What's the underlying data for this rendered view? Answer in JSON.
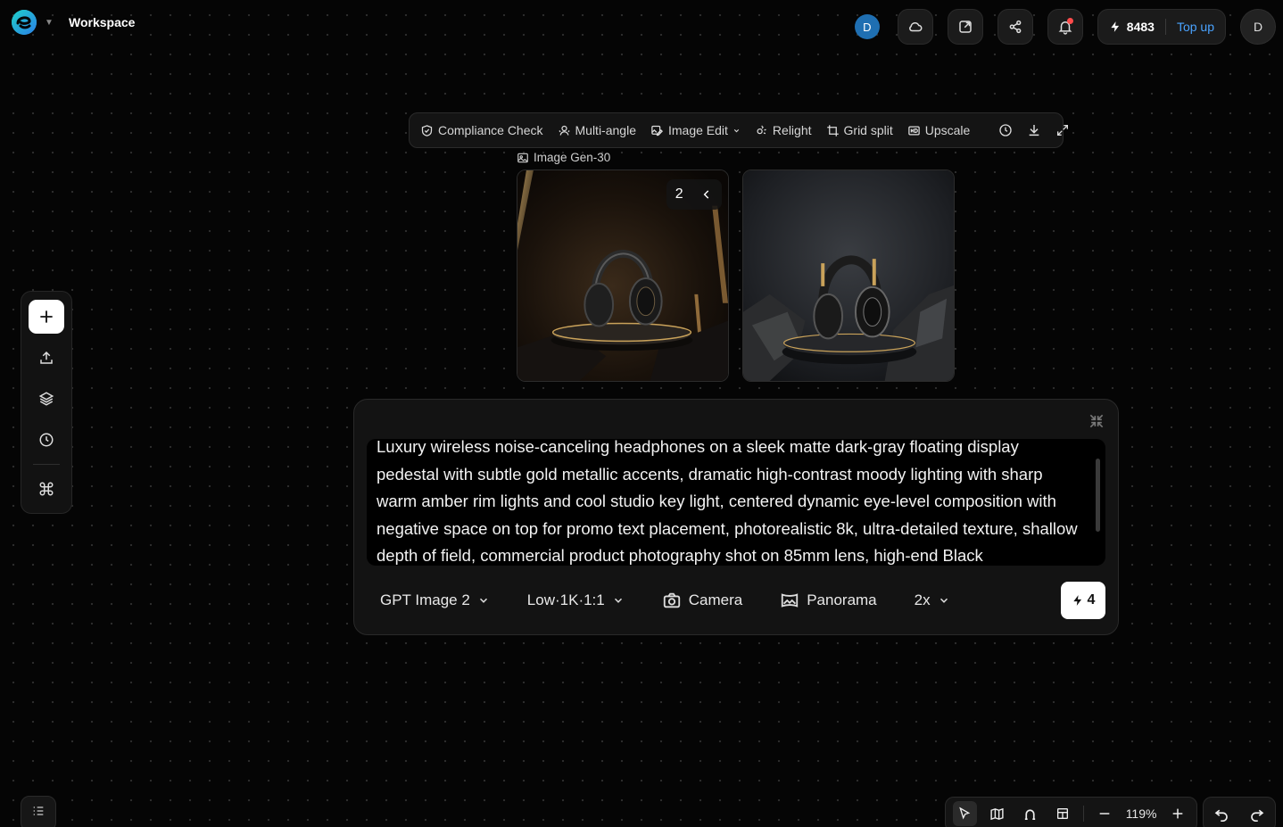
{
  "header": {
    "workspace_title": "Workspace",
    "user_initial": "D",
    "credits": "8483",
    "topup_label": "Top up",
    "avatar_initial": "D"
  },
  "image_toolbar": {
    "items": [
      {
        "label": "Compliance Check",
        "icon": "shield-check-icon"
      },
      {
        "label": "Multi-angle",
        "icon": "multi-angle-icon"
      },
      {
        "label": "Image Edit",
        "icon": "image-edit-icon"
      },
      {
        "label": "Relight",
        "icon": "relight-icon"
      },
      {
        "label": "Grid split",
        "icon": "crop-icon"
      },
      {
        "label": "Upscale",
        "icon": "hd-icon"
      }
    ]
  },
  "node": {
    "label": "Image Gen-30",
    "pager_count": "2"
  },
  "prompt": {
    "text": "Luxury wireless noise-canceling headphones on a sleek matte dark-gray floating display pedestal with subtle gold metallic accents, dramatic high-contrast moody lighting with sharp warm amber rim lights and cool studio key light, centered dynamic eye-level composition with negative space on top for promo text placement, photorealistic 8k, ultra-detailed texture, shallow depth of field, commercial product photography shot on 85mm lens, high-end Black"
  },
  "controls": {
    "model": "GPT Image 2",
    "quality": "Low·1K·1:1",
    "camera": "Camera",
    "panorama": "Panorama",
    "count": "2x",
    "cost": "4"
  },
  "bottom_bar": {
    "zoom": "119%"
  },
  "colors": {
    "accent_blue": "#4aa3ff",
    "user_badge": "#1f6fb2",
    "notification": "#ff4b4b",
    "gold_accent": "#c9a25a"
  }
}
